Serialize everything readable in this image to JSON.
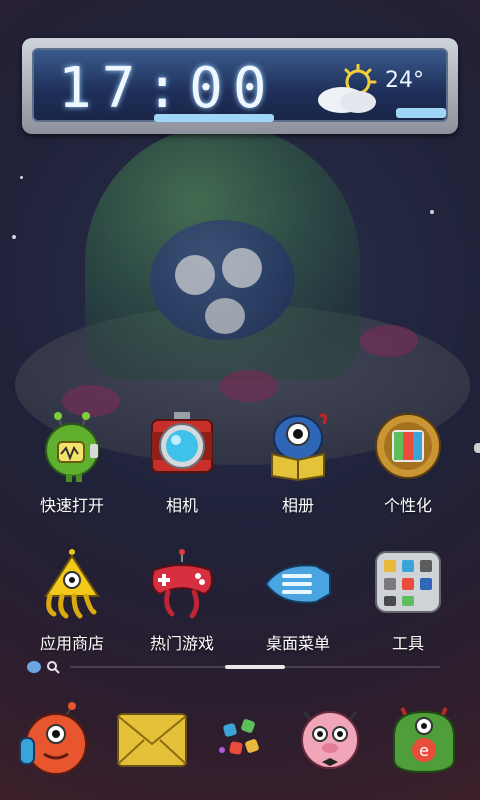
{
  "clock_widget": {
    "time": "17:00",
    "temperature": "24°",
    "weather_icon": "sun-cloud-icon"
  },
  "apps_row1": [
    {
      "label": "快速打开",
      "icon": "green-robot-icon"
    },
    {
      "label": "相机",
      "icon": "camera-icon"
    },
    {
      "label": "相册",
      "icon": "one-eye-monster-book-icon"
    },
    {
      "label": "个性化",
      "icon": "personalize-icon"
    }
  ],
  "apps_row2": [
    {
      "label": "应用商店",
      "icon": "yellow-squid-icon"
    },
    {
      "label": "热门游戏",
      "icon": "gamepad-icon"
    },
    {
      "label": "桌面菜单",
      "icon": "blue-capsule-icon"
    },
    {
      "label": "工具",
      "icon": "toolbox-icon"
    }
  ],
  "dock": [
    {
      "icon": "phone-monster-icon"
    },
    {
      "icon": "envelope-icon"
    },
    {
      "icon": "app-drawer-icon"
    },
    {
      "icon": "pink-monster-icon"
    },
    {
      "icon": "browser-monster-icon"
    }
  ],
  "colors": {
    "widget_digits": "#eef6ff",
    "label_text": "#ffffff",
    "accent_blue": "#9fd6f6"
  }
}
